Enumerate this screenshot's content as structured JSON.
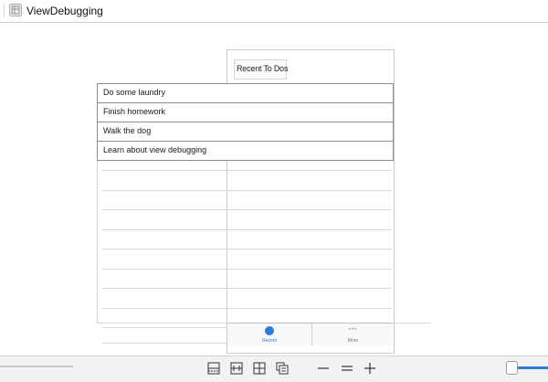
{
  "window": {
    "title": "ViewDebugging"
  },
  "navbar": {
    "title": "Recent To Dos"
  },
  "todos": [
    {
      "text": "Do some laundry"
    },
    {
      "text": "Finish homework"
    },
    {
      "text": "Walk the dog"
    },
    {
      "text": "Learn about view debugging"
    }
  ],
  "tabbar": {
    "tabs": [
      {
        "label": "Recent",
        "icon": "circle-icon",
        "selected": true
      },
      {
        "label": "More",
        "icon": "more-dots-icon",
        "selected": false
      }
    ],
    "more_dots": "•••"
  },
  "toolbar": {
    "icons": [
      "layout-top-icon",
      "layout-center-icon",
      "layout-grid-icon",
      "layout-layers-icon",
      "zoom-out-icon",
      "zoom-reset-icon",
      "zoom-in-icon"
    ]
  },
  "colors": {
    "accent": "#2d7be0"
  }
}
